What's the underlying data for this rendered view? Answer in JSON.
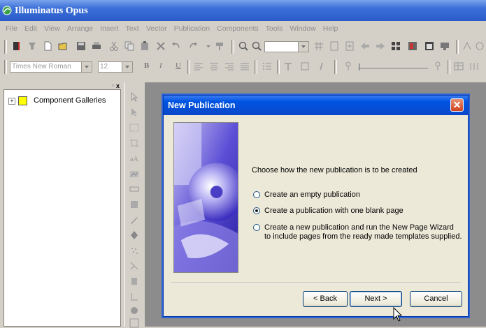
{
  "app": {
    "title": "Illuminatus Opus"
  },
  "menu": [
    "File",
    "Edit",
    "View",
    "Arrange",
    "Insert",
    "Text",
    "Vector",
    "Publication",
    "Components",
    "Tools",
    "Window",
    "Help"
  ],
  "format_bar": {
    "font_name": "Times New Roman",
    "font_size": "12",
    "bold": "B",
    "italic": "I",
    "underline": "U"
  },
  "panel": {
    "tree_item": "Component Galleries",
    "expander": "+",
    "close": "x"
  },
  "dialog": {
    "title": "New Publication",
    "instruction": "Choose how the new publication is to be created",
    "options": [
      {
        "label": "Create an empty publication",
        "checked": false
      },
      {
        "label": "Create a publication with one blank page",
        "checked": true
      },
      {
        "label": "Create a new publication and run the New Page Wizard",
        "label2": "to include pages from the ready made templates supplied.",
        "checked": false
      }
    ],
    "buttons": {
      "back": "< Back",
      "next": "Next >",
      "cancel": "Cancel"
    }
  },
  "colors": {
    "titlebar": "#2a5cc9",
    "dialog_title": "#0054e3",
    "canvas": "#8c8c8c",
    "folder": "#ffff00"
  }
}
